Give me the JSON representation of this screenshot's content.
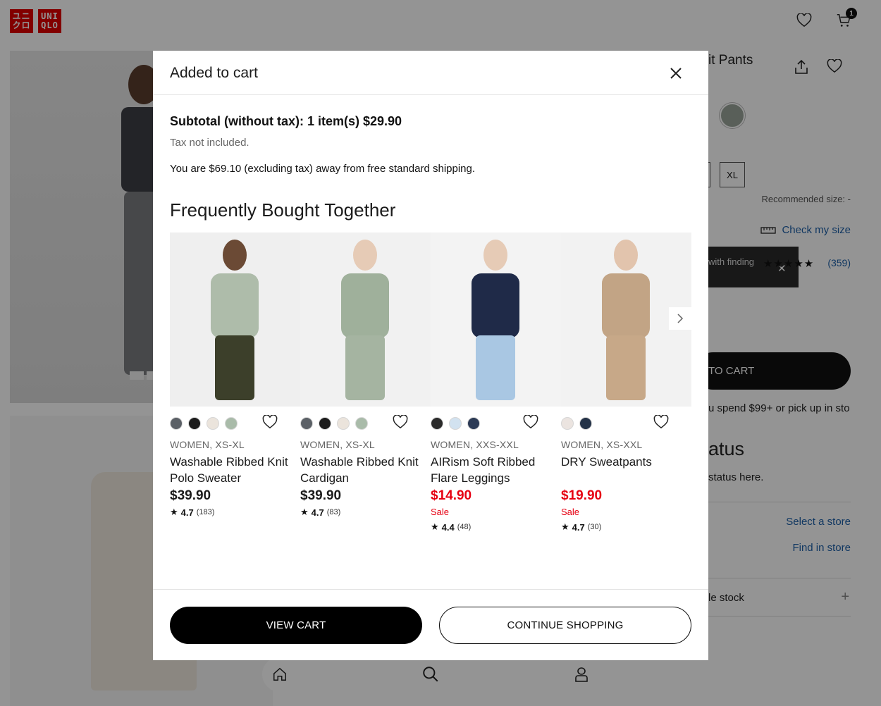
{
  "brand": {
    "logo_top": "ユニ クロ",
    "logo_text_1": "UNI",
    "logo_text_2": "QLO",
    "accent": "#e00000"
  },
  "header": {
    "cart_count": "1",
    "icons": [
      "heart-icon",
      "cart-icon"
    ]
  },
  "product_page": {
    "title_fragment": "it Pants",
    "size_xl": "XL",
    "recommended_size": "Recommended size: -",
    "check_my_size": "Check my size",
    "tooltip_text": "with finding",
    "rating_stars": "★★★★★",
    "review_count": "(359)",
    "add_to_cart": "TO CART",
    "shipping_note": "u spend $99+ or pick up in sto",
    "status_heading": "atus",
    "status_sub": "status here.",
    "select_store": "Select a store",
    "find_in_store": "Find in store",
    "stock_label": "le stock",
    "plus": "+"
  },
  "modal": {
    "title": "Added to cart",
    "subtotal": "Subtotal (without tax): 1 item(s) $29.90",
    "tax_note": "Tax not included.",
    "shipping_note": "You are $69.10 (excluding tax) away from free standard shipping.",
    "fbt_title": "Frequently Bought Together",
    "view_cart": "VIEW CART",
    "continue_shopping": "CONTINUE SHOPPING"
  },
  "products": [
    {
      "meta": "WOMEN, XS-XL",
      "name": "Washable Ribbed Knit Polo Sweater",
      "price": "$39.90",
      "sale": "",
      "rating": "4.7",
      "count": "(183)",
      "swatches": [
        "#5b6066",
        "#1c1c1c",
        "#ebe4dc",
        "#a9bba9"
      ],
      "colors": {
        "top": "#aebcaa",
        "bottom": "#3c3f2a",
        "skin": "#6b4a35"
      }
    },
    {
      "meta": "WOMEN, XS-XL",
      "name": "Washable Ribbed Knit Cardigan",
      "price": "$39.90",
      "sale": "",
      "rating": "4.7",
      "count": "(83)",
      "swatches": [
        "#5b6066",
        "#1c1c1c",
        "#ebe4dc",
        "#a9bba9"
      ],
      "colors": {
        "top": "#9fb09b",
        "bottom": "#a5b4a1",
        "skin": "#e6cbb6"
      }
    },
    {
      "meta": "WOMEN, XXS-XXL",
      "name": "AIRism Soft Ribbed Flare Leggings",
      "price": "$14.90",
      "sale": "Sale",
      "rating": "4.4",
      "count": "(48)",
      "swatches": [
        "#2b2b2b",
        "#d2e2f0",
        "#2c3a55"
      ],
      "colors": {
        "top": "#1f2a48",
        "bottom": "#a9c7e3",
        "skin": "#e6cbb6"
      }
    },
    {
      "meta": "WOMEN, XS-XXL",
      "name": "DRY Sweatpants",
      "price": "$19.90",
      "sale": "Sale",
      "rating": "4.7",
      "count": "(30)",
      "swatches": [
        "#ebe4e0",
        "#243247"
      ],
      "colors": {
        "top": "#c2a485",
        "bottom": "#c7a888",
        "skin": "#e2c4ad"
      }
    }
  ]
}
